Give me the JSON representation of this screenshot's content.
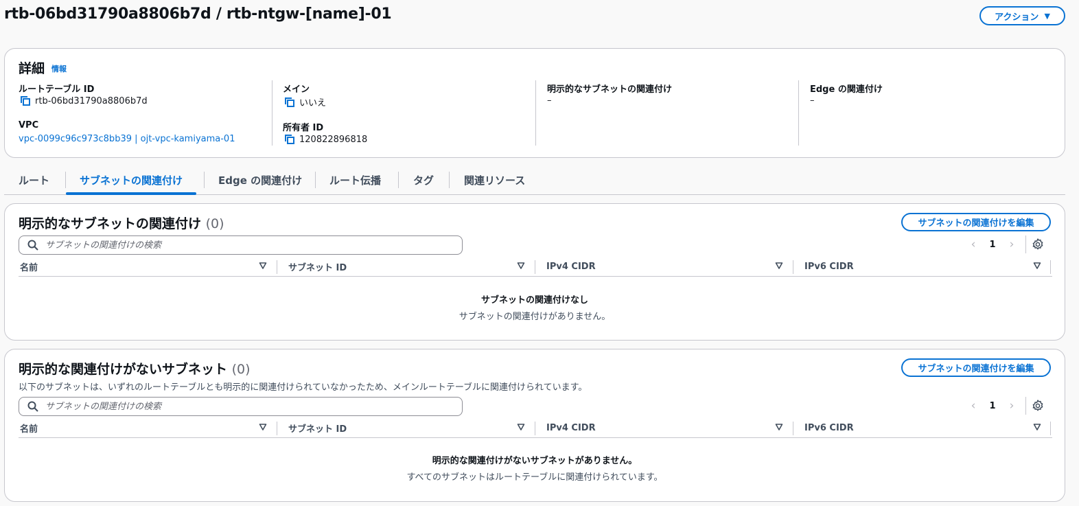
{
  "header": {
    "title": "rtb-06bd31790a8806b7d / rtb-ntgw-[name]-01",
    "actions_label": "アクション",
    "actions_caret": "▼"
  },
  "details": {
    "title": "詳細",
    "info_link": "情報",
    "fields": {
      "route_table_id": {
        "label": "ルートテーブル ID",
        "value": "rtb-06bd31790a8806b7d"
      },
      "vpc": {
        "label": "VPC",
        "value": "vpc-0099c96c973c8bb39 | ojt-vpc-kamiyama-01"
      },
      "main": {
        "label": "メイン",
        "value": "いいえ"
      },
      "owner_id": {
        "label": "所有者 ID",
        "value": "120822896818"
      },
      "explicit_subnet_assoc": {
        "label": "明示的なサブネットの関連付け",
        "value": "–"
      },
      "edge_assoc": {
        "label": "Edge の関連付け",
        "value": "–"
      }
    }
  },
  "tabs": [
    {
      "label": "ルート",
      "active": false
    },
    {
      "label": "サブネットの関連付け",
      "active": true
    },
    {
      "label": "Edge の関連付け",
      "active": false
    },
    {
      "label": "ルート伝播",
      "active": false
    },
    {
      "label": "タグ",
      "active": false
    },
    {
      "label": "関連リソース",
      "active": false
    }
  ],
  "explicit_section": {
    "title": "明示的なサブネットの関連付け",
    "count": "(0)",
    "edit_button": "サブネットの関連付けを編集",
    "search_placeholder": "サブネットの関連付けの検索",
    "page": "1",
    "columns": [
      "名前",
      "サブネット ID",
      "IPv4 CIDR",
      "IPv6 CIDR"
    ],
    "empty_title": "サブネットの関連付けなし",
    "empty_message": "サブネットの関連付けがありません。"
  },
  "implicit_section": {
    "title": "明示的な関連付けがないサブネット",
    "count": "(0)",
    "description": "以下のサブネットは、いずれのルートテーブルとも明示的に関連付けられていなかったため、メインルートテーブルに関連付けられています。",
    "edit_button": "サブネットの関連付けを編集",
    "search_placeholder": "サブネットの関連付けの検索",
    "page": "1",
    "columns": [
      "名前",
      "サブネット ID",
      "IPv4 CIDR",
      "IPv6 CIDR"
    ],
    "empty_title": "明示的な関連付けがないサブネットがありません。",
    "empty_message": "すべてのサブネットはルートテーブルに関連付けられています。"
  },
  "colors": {
    "accent": "#0972d3",
    "border": "#c6c6cd",
    "text": "#16191f"
  },
  "icons": [
    "copy-icon",
    "search-icon",
    "chevron-left-icon",
    "chevron-right-icon",
    "gear-icon",
    "sort-icon",
    "caret-down-icon"
  ]
}
